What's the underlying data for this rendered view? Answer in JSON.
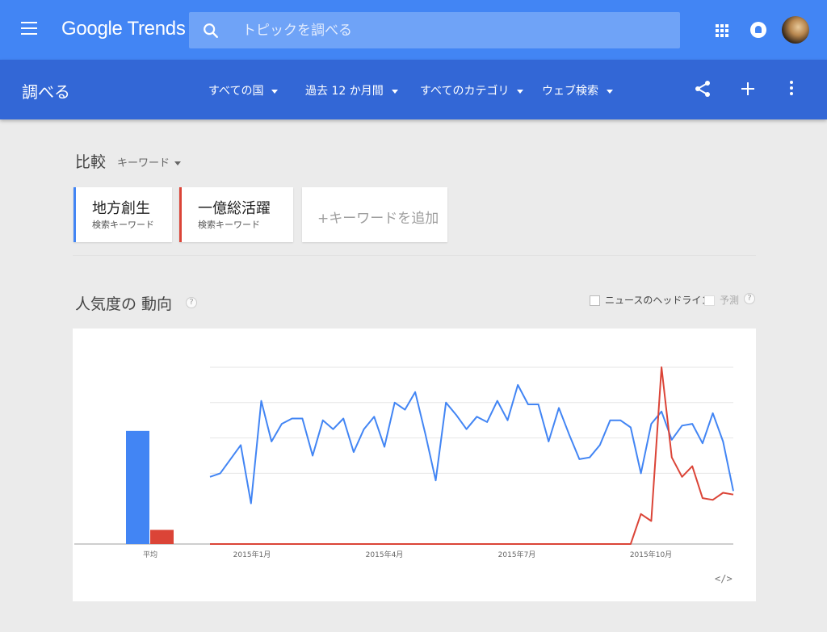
{
  "header": {
    "logo": "Google Trends",
    "search_placeholder": "トピックを調べる"
  },
  "subheader": {
    "title": "調べる",
    "filters": [
      "すべての国",
      "過去 12 か月間",
      "すべてのカテゴリ",
      "ウェブ検索"
    ]
  },
  "compare": {
    "label": "比較",
    "type": "キーワード",
    "keywords": [
      {
        "term": "地方創生",
        "type": "検索キーワード",
        "color": "#4285f4"
      },
      {
        "term": "一億総活躍",
        "type": "検索キーワード",
        "color": "#db4437"
      }
    ],
    "add_label": "+キーワードを追加"
  },
  "trend": {
    "title": "人気度の 動向",
    "news_option": "ニュースのヘッドライン",
    "forecast_option": "予測",
    "help": "?",
    "embed": "</>"
  },
  "chart_data": {
    "type": "line",
    "ylim": [
      0,
      100
    ],
    "grid": true,
    "x_tick_labels": [
      "2015年1月",
      "2015年4月",
      "2015年7月",
      "2015年10月"
    ],
    "average_label": "平均",
    "averages": [
      64,
      8
    ],
    "series": [
      {
        "name": "地方創生",
        "color": "#4285f4",
        "values": [
          38,
          40,
          48,
          56,
          23,
          81,
          58,
          68,
          71,
          71,
          50,
          70,
          65,
          71,
          52,
          65,
          72,
          55,
          80,
          76,
          86,
          62,
          36,
          80,
          73,
          65,
          72,
          69,
          81,
          70,
          90,
          79,
          79,
          58,
          77,
          62,
          48,
          49,
          56,
          70,
          70,
          66,
          40,
          68,
          75,
          59,
          67,
          68,
          57,
          74,
          58,
          30
        ]
      },
      {
        "name": "一億総活躍",
        "color": "#db4437",
        "values": [
          0,
          0,
          0,
          0,
          0,
          0,
          0,
          0,
          0,
          0,
          0,
          0,
          0,
          0,
          0,
          0,
          0,
          0,
          0,
          0,
          0,
          0,
          0,
          0,
          0,
          0,
          0,
          0,
          0,
          0,
          0,
          0,
          0,
          0,
          0,
          0,
          0,
          0,
          0,
          0,
          0,
          0,
          17,
          13,
          100,
          49,
          38,
          44,
          26,
          25,
          29,
          28
        ]
      }
    ]
  }
}
